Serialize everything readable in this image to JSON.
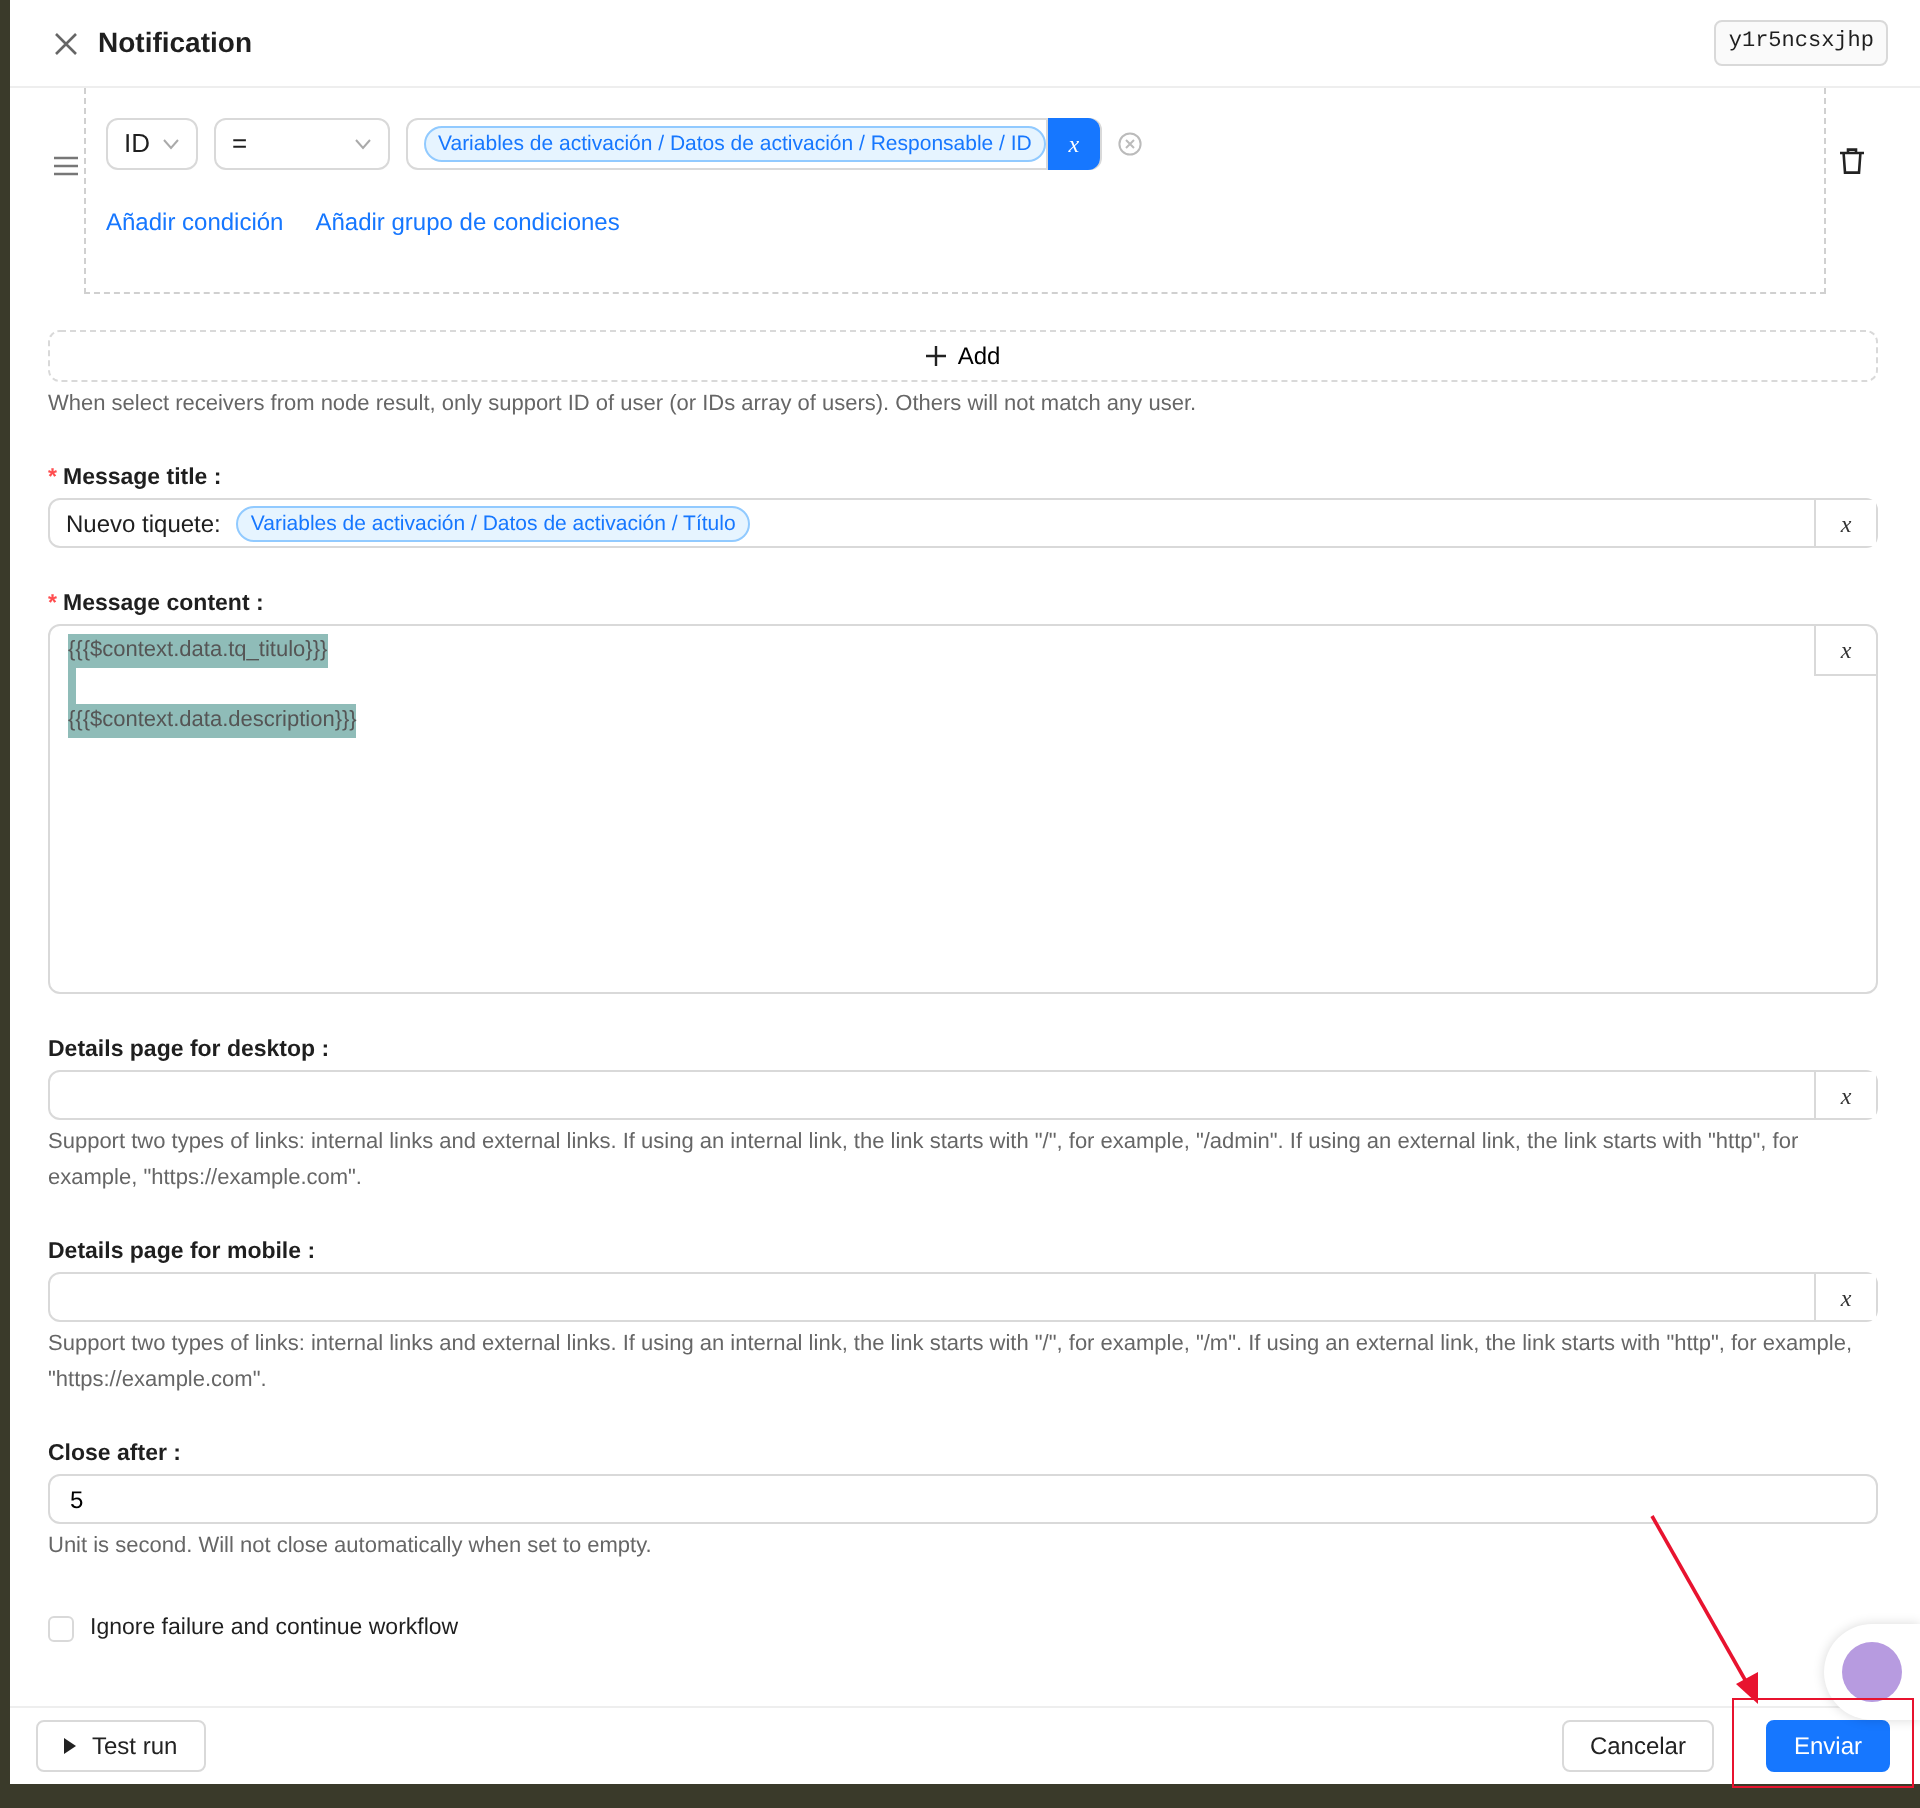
{
  "header": {
    "title": "Notification",
    "node_key": "y1r5ncsxjhp"
  },
  "condition_group": {
    "field": "ID",
    "operator": "=",
    "value_tag": "Variables de activación / Datos de activación / Responsable / ID",
    "variable_button": "x",
    "links": [
      "Añadir condición",
      "Añadir grupo de condiciones"
    ]
  },
  "add_button": "Add",
  "receivers_help": "When select receivers from node result, only support ID of user (or IDs array of users). Others will not match any user.",
  "fields": [
    {
      "kind": "tagged_input",
      "label": "Message title :",
      "required_mark": "*",
      "prefix": "Nuevo tiquete:",
      "tag": "Variables de activación / Datos de activación / Título",
      "variable_button": "x"
    },
    {
      "kind": "rich_text",
      "label": "Message content :",
      "required_mark": "*",
      "paragraphs": [
        "{{{$context.data.tq_titulo}}}",
        "{{{$context.data.description}}}"
      ],
      "variable_button": "x"
    },
    {
      "kind": "url_input",
      "label": "Details page for desktop :",
      "variable_button": "x",
      "help": "Support two types of links: internal links and external links. If using an internal link, the link starts with \"/\", for example, \"/admin\". If using an external link, the link starts with \"http\", for example, \"https://example.com\"."
    },
    {
      "kind": "url_input",
      "label": "Details page for mobile :",
      "variable_button": "x",
      "help": "Support two types of links: internal links and external links. If using an internal link, the link starts with \"/\", for example, \"/m\". If using an external link, the link starts with \"http\", for example, \"https://example.com\"."
    },
    {
      "kind": "number_input",
      "label": "Close after :",
      "value": "5",
      "help": "Unit is second. Will not close automatically when set to empty."
    }
  ],
  "ignore_failure": {
    "label": "Ignore failure and continue workflow",
    "checked": false
  },
  "footer": {
    "test_run": "Test run",
    "cancel": "Cancelar",
    "submit": "Enviar"
  }
}
